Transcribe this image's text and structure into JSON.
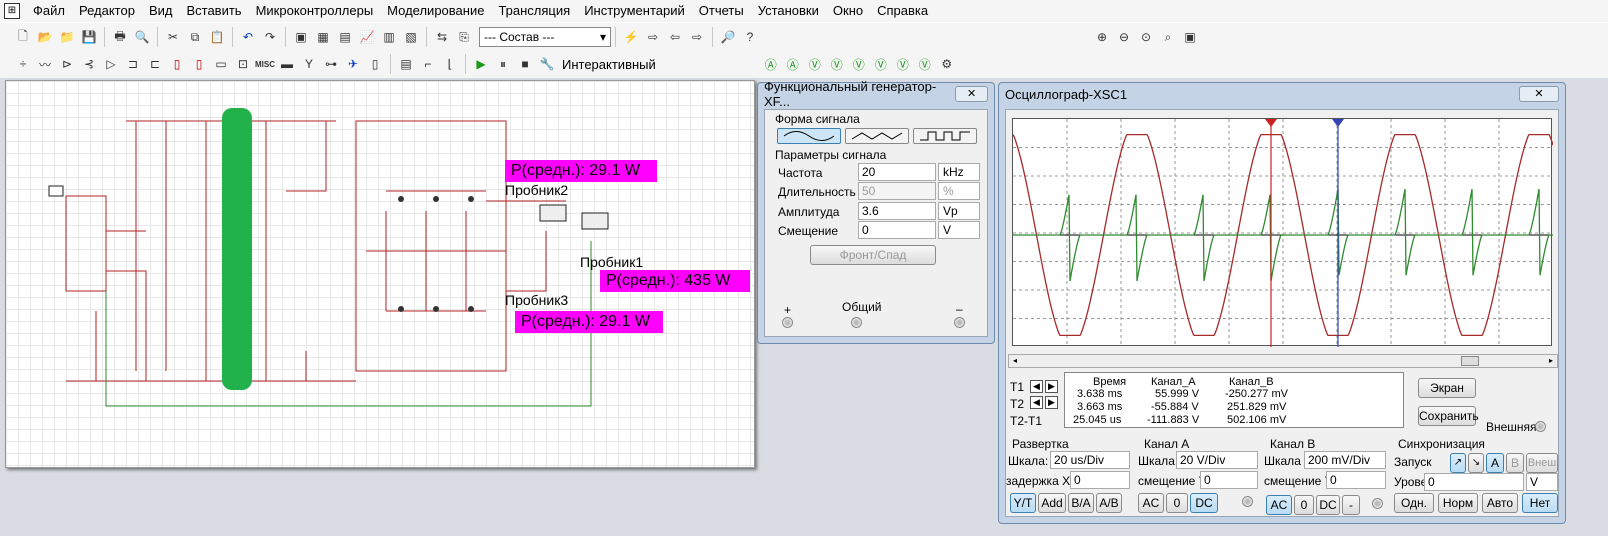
{
  "menu": {
    "items": [
      "Файл",
      "Редактор",
      "Вид",
      "Вставить",
      "Микроконтроллеры",
      "Моделирование",
      "Трансляция",
      "Инструментарий",
      "Отчеты",
      "Установки",
      "Окно",
      "Справка"
    ]
  },
  "toolbar1": {
    "combo_value": "--- Состав ---"
  },
  "toolbar2": {
    "misc_label": "MISC",
    "interactive_label": "Интерактивный"
  },
  "probes": {
    "p2_name": "Пробник2",
    "p2_value": "P(средн.): 29.1 W",
    "p1_name": "Пробник1",
    "p1_value": "P(средн.): 435 W",
    "p3_name": "Пробник3",
    "p3_value": "P(средн.): 29.1 W"
  },
  "generator": {
    "title": "Функциональный генератор-XF...",
    "close": "✕",
    "waveform_label": "Форма сигнала",
    "params_label": "Параметры сигнала",
    "freq_label": "Частота",
    "freq_value": "20",
    "freq_unit": "kHz",
    "duty_label": "Длительность",
    "duty_value": "50",
    "duty_unit": "%",
    "amp_label": "Амплитуда",
    "amp_value": "3.6",
    "amp_unit": "Vp",
    "offset_label": "Смещение",
    "offset_value": "0",
    "offset_unit": "V",
    "edge_button": "Фронт/Спад",
    "plus": "+",
    "common": "Общий",
    "minus": "–"
  },
  "scope": {
    "title": "Осциллограф-XSC1",
    "close": "✕",
    "cursor_labels": [
      "T1",
      "T2",
      "T2-T1"
    ],
    "headers": [
      "Время",
      "Канал_A",
      "Канал_B"
    ],
    "rows": [
      [
        "3.638 ms",
        "55.999 V",
        "-250.277 mV"
      ],
      [
        "3.663 ms",
        "-55.884 V",
        "251.829 mV"
      ],
      [
        "25.045 us",
        "-111.883 V",
        "502.106 mV"
      ]
    ],
    "screen_button": "Экран",
    "save_button": "Сохранить",
    "external_label": "Внешняя",
    "timebase": {
      "label": "Развертка",
      "scale_label": "Шкала:",
      "scale_value": "20 us/Div",
      "delay_label": "задержка X",
      "delay_value": "0",
      "buttons": [
        "Y/T",
        "Add",
        "B/A",
        "A/B"
      ]
    },
    "channel_a": {
      "label": "Канал A",
      "scale_label": "Шкала",
      "scale_value": "20  V/Div",
      "offset_label": "смещение Y",
      "offset_value": "0",
      "buttons": [
        "AC",
        "0",
        "DC"
      ]
    },
    "channel_b": {
      "label": "Канал B",
      "scale_label": "Шкала",
      "scale_value": "200 mV/Div",
      "offset_label": "смещение Y",
      "offset_value": "0",
      "buttons": [
        "AC",
        "0",
        "DC",
        "-"
      ]
    },
    "trigger": {
      "label": "Синхронизация",
      "start_label": "Запуск",
      "edge_buttons": [
        "↗",
        "↘",
        "A",
        "B",
        "Внеш"
      ],
      "level_label": "Уровень",
      "level_value": "0",
      "level_unit": "V",
      "mode_buttons": [
        "Одн.",
        "Норм",
        "Авто",
        "Нет"
      ]
    },
    "colors": {
      "channel_a": "#a52a2a",
      "channel_b": "#2e8b2e",
      "cursor_t1": "#cc2222",
      "cursor_t2": "#3344bb"
    }
  }
}
